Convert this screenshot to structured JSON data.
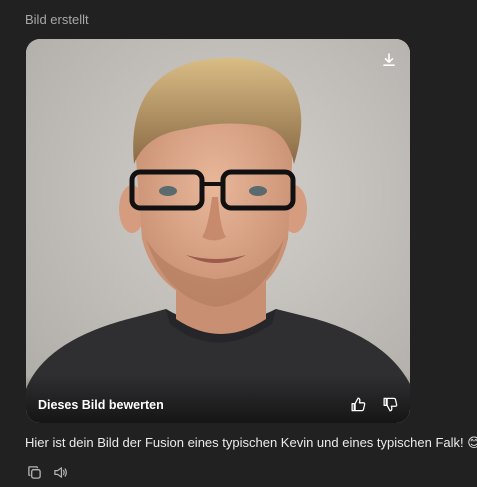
{
  "header": {
    "status": "Bild erstellt"
  },
  "image": {
    "rate_label": "Dieses Bild bewerten",
    "download_icon": "download-icon",
    "thumbs_up_icon": "thumbs-up-icon",
    "thumbs_down_icon": "thumbs-down-icon"
  },
  "message": {
    "text": "Hier ist dein Bild der Fusion eines typischen Kevin und eines typischen Falk! 😊"
  },
  "actions": {
    "copy_icon": "copy-icon",
    "read_aloud_icon": "speaker-icon"
  }
}
